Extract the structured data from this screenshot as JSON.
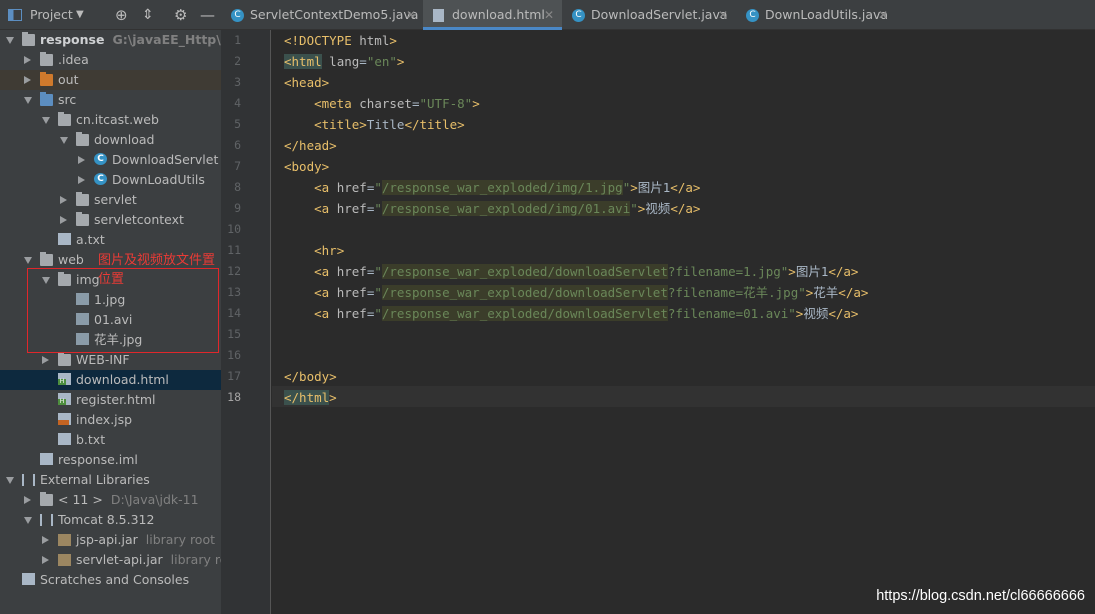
{
  "project_panel": {
    "title": "Project",
    "annotation": "图片及视频放文件置位置",
    "tree": [
      {
        "label": "response",
        "extra": "G:\\javaEE_Http\\http_",
        "level": 0,
        "expanded": true,
        "icon": "folder",
        "bold": true
      },
      {
        "label": ".idea",
        "level": 1,
        "expanded": false,
        "icon": "folder"
      },
      {
        "label": "out",
        "level": 1,
        "expanded": false,
        "icon": "folder-orange"
      },
      {
        "label": "src",
        "level": 1,
        "expanded": true,
        "icon": "folder-blue"
      },
      {
        "label": "cn.itcast.web",
        "level": 2,
        "expanded": true,
        "icon": "package"
      },
      {
        "label": "download",
        "level": 3,
        "expanded": true,
        "icon": "package"
      },
      {
        "label": "DownloadServlet",
        "level": 4,
        "expanded": false,
        "icon": "class"
      },
      {
        "label": "DownLoadUtils",
        "level": 4,
        "expanded": false,
        "icon": "class"
      },
      {
        "label": "servlet",
        "level": 3,
        "expanded": false,
        "icon": "package"
      },
      {
        "label": "servletcontext",
        "level": 3,
        "expanded": false,
        "icon": "package"
      },
      {
        "label": "a.txt",
        "level": 2,
        "icon": "file"
      },
      {
        "label": "web",
        "level": 1,
        "expanded": true,
        "icon": "folder-web"
      },
      {
        "label": "img",
        "level": 2,
        "expanded": true,
        "icon": "folder"
      },
      {
        "label": "1.jpg",
        "level": 3,
        "icon": "image-file"
      },
      {
        "label": "01.avi",
        "level": 3,
        "icon": "unknown-file"
      },
      {
        "label": "花羊.jpg",
        "level": 3,
        "icon": "image-file"
      },
      {
        "label": "WEB-INF",
        "level": 2,
        "expanded": false,
        "icon": "folder"
      },
      {
        "label": "download.html",
        "level": 2,
        "icon": "html-file",
        "selected": true
      },
      {
        "label": "register.html",
        "level": 2,
        "icon": "html-file"
      },
      {
        "label": "index.jsp",
        "level": 2,
        "icon": "jsp-file"
      },
      {
        "label": "b.txt",
        "level": 2,
        "icon": "file"
      },
      {
        "label": "response.iml",
        "level": 1,
        "icon": "iml-file"
      },
      {
        "label": "External Libraries",
        "level": 0,
        "expanded": true,
        "icon": "library"
      },
      {
        "label": "< 11 >",
        "extra": "D:\\Java\\jdk-11",
        "level": 1,
        "expanded": false,
        "icon": "jdk"
      },
      {
        "label": "Tomcat 8.5.312",
        "level": 1,
        "expanded": true,
        "icon": "library"
      },
      {
        "label": "jsp-api.jar",
        "extra": "library root",
        "level": 2,
        "expanded": false,
        "icon": "jar"
      },
      {
        "label": "servlet-api.jar",
        "extra": "library root",
        "level": 2,
        "expanded": false,
        "icon": "jar"
      },
      {
        "label": "Scratches and Consoles",
        "level": 0,
        "icon": "scratches"
      }
    ]
  },
  "tabs": [
    {
      "label": "ServletContextDemo5.java",
      "icon": "class-icon",
      "active": false
    },
    {
      "label": "download.html",
      "icon": "html-file-icon",
      "active": true
    },
    {
      "label": "DownloadServlet.java",
      "icon": "class-icon",
      "active": false
    },
    {
      "label": "DownLoadUtils.java",
      "icon": "class-icon",
      "active": false
    }
  ],
  "editor": {
    "line_numbers": [
      "1",
      "2",
      "3",
      "4",
      "5",
      "6",
      "7",
      "8",
      "9",
      "10",
      "11",
      "12",
      "13",
      "14",
      "15",
      "16",
      "17",
      "18"
    ],
    "current_line": "18",
    "lines": [
      "<!DOCTYPE html>",
      "<html lang=\"en\">",
      "<head>",
      "    <meta charset=\"UTF-8\">",
      "    <title>Title</title>",
      "</head>",
      "<body>",
      "    <a href=\"/response_war_exploded/img/1.jpg\">图片1</a>",
      "    <a href=\"/response_war_exploded/img/01.avi\">视频</a>",
      "",
      "    <hr>",
      "    <a href=\"/response_war_exploded/downloadServlet?filename=1.jpg\">图片1</a>",
      "    <a href=\"/response_war_exploded/downloadServlet?filename=花羊.jpg\">花羊</a>",
      "    <a href=\"/response_war_exploded/downloadServlet?filename=01.avi\">视频</a>",
      "",
      "",
      "</body>",
      "</html>"
    ]
  },
  "watermark": "https://blog.csdn.net/cl66666666",
  "colors": {
    "tag": "#e8bf6a",
    "string": "#6a8759",
    "selected_row": "#0d293e",
    "annotation": "#e0272b"
  }
}
